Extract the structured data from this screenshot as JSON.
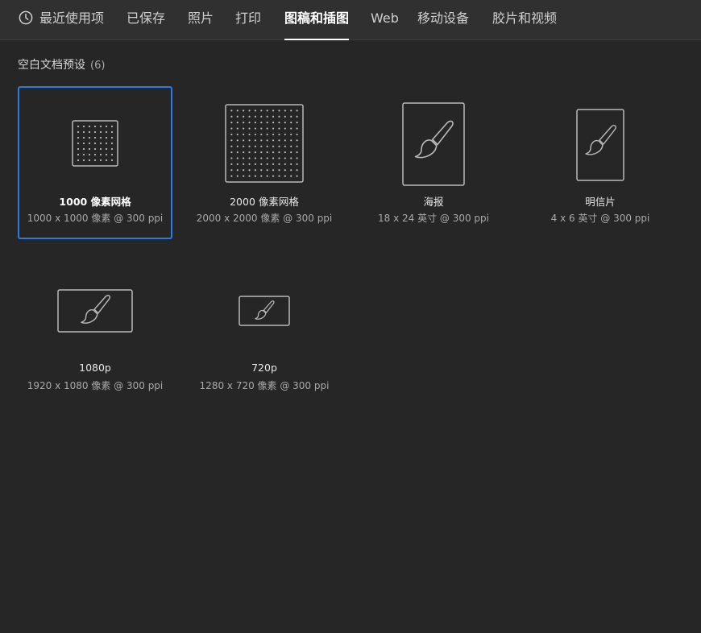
{
  "tabs": [
    {
      "label": "最近使用项"
    },
    {
      "label": "已保存"
    },
    {
      "label": "照片"
    },
    {
      "label": "打印"
    },
    {
      "label": "图稿和插图"
    },
    {
      "label": "Web"
    },
    {
      "label": "移动设备"
    },
    {
      "label": "胶片和视频"
    }
  ],
  "active_tab": "图稿和插图",
  "section": {
    "title": "空白文档预设",
    "count": "(6)"
  },
  "presets": [
    {
      "name": "1000 像素网格",
      "dims": "1000 x 1000 像素 @ 300 ppi",
      "icon": "grid-document-icon",
      "selected": true
    },
    {
      "name": "2000 像素网格",
      "dims": "2000 x 2000 像素 @ 300 ppi",
      "icon": "grid-document-icon",
      "selected": false
    },
    {
      "name": "海报",
      "dims": "18 x 24 英寸 @ 300 ppi",
      "icon": "brush-document-icon",
      "selected": false
    },
    {
      "name": "明信片",
      "dims": "4 x 6 英寸 @ 300 ppi",
      "icon": "brush-document-icon",
      "selected": false
    },
    {
      "name": "1080p",
      "dims": "1920 x 1080 像素 @ 300 ppi",
      "icon": "brush-document-icon",
      "selected": false
    },
    {
      "name": "720p",
      "dims": "1280 x 720 像素 @ 300 ppi",
      "icon": "brush-document-icon",
      "selected": false
    }
  ],
  "colors": {
    "background": "#262626",
    "tabbar": "#303030",
    "selection": "#2c7be0",
    "icon_stroke": "#b9b9b9"
  }
}
